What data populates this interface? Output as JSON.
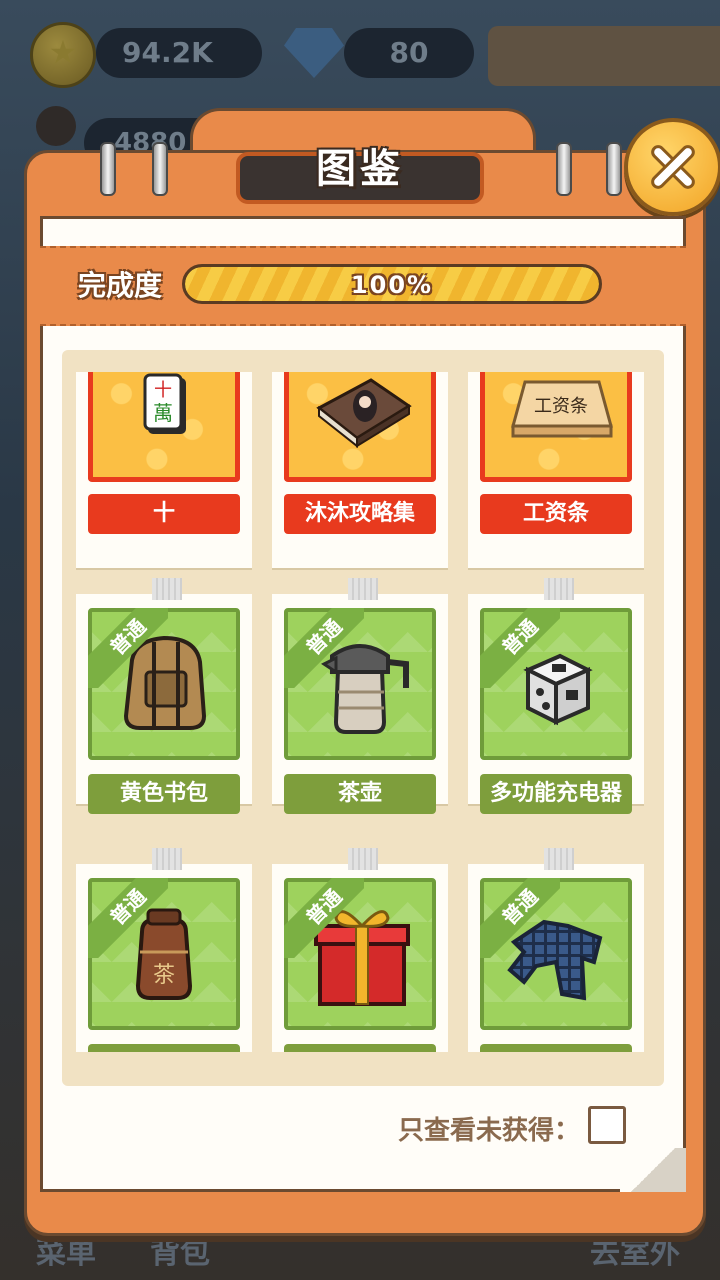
{
  "hud": {
    "coins": "94.2K",
    "gems": "80",
    "fans": "4880"
  },
  "bottom_nav": {
    "menu": "菜单",
    "bag": "背包",
    "outdoor": "去室外"
  },
  "dialog": {
    "title": "图鉴",
    "progress_label": "完成度",
    "progress_value": 1.0,
    "progress_text": "100%",
    "filter_label": "只查看未获得：",
    "filter_checked": false
  },
  "items": [
    {
      "name": "十",
      "rarity": "",
      "tier": "gold",
      "icon": "mahjong-tile-icon"
    },
    {
      "name": "沐沐攻略集",
      "rarity": "",
      "tier": "gold",
      "icon": "guide-book-icon"
    },
    {
      "name": "工资条",
      "rarity": "",
      "tier": "gold",
      "icon": "payslip-icon",
      "icon_text": "工资条"
    },
    {
      "name": "黄色书包",
      "rarity": "普通",
      "tier": "green",
      "icon": "backpack-icon"
    },
    {
      "name": "茶壶",
      "rarity": "普通",
      "tier": "green",
      "icon": "teapot-icon"
    },
    {
      "name": "多功能充电器",
      "rarity": "普通",
      "tier": "green",
      "icon": "charger-cube-icon"
    },
    {
      "name": "",
      "rarity": "普通",
      "tier": "green",
      "icon": "tea-jar-icon",
      "icon_text": "茶"
    },
    {
      "name": "",
      "rarity": "普通",
      "tier": "green",
      "icon": "gift-box-icon"
    },
    {
      "name": "",
      "rarity": "普通",
      "tier": "green",
      "icon": "plaid-shirt-icon"
    }
  ],
  "colors": {
    "frame": "#e98a4a",
    "gold_tier": "#fbbf44",
    "gold_accent": "#e83a1e",
    "green_tier": "#9ed25d",
    "green_label": "#7e9e3c"
  }
}
